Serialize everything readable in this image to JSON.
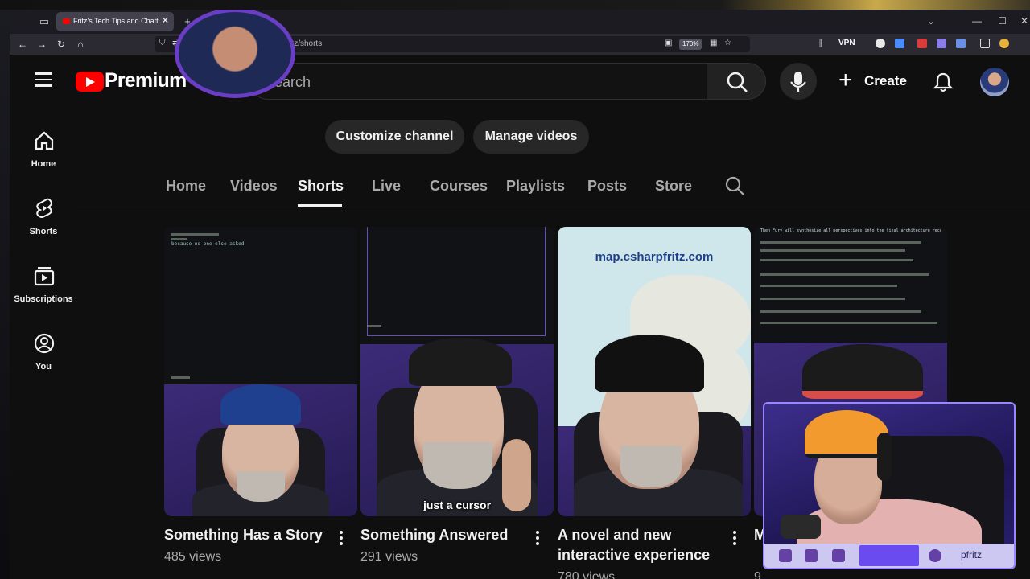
{
  "browser": {
    "tab_title": "Fritz's Tech Tips and Chatter - YouTube",
    "url": "www.youtube.com/@csharpfritz/shorts",
    "zoom": "170%",
    "vpn_label": "VPN",
    "close_glyph": "✕",
    "new_tab_glyph": "+",
    "back_glyph": "←",
    "forward_glyph": "→",
    "reload_glyph": "↻",
    "home_glyph": "⌂",
    "minimize_glyph": "—",
    "maximize_glyph": "☐",
    "list_glyph": "⌄"
  },
  "masthead": {
    "logo_text": "Premium",
    "search_placeholder": "Search",
    "create_label": "Create"
  },
  "guide": {
    "items": [
      {
        "label": "Home",
        "icon": "home-icon"
      },
      {
        "label": "Shorts",
        "icon": "shorts-icon"
      },
      {
        "label": "Subscriptions",
        "icon": "subscriptions-icon"
      },
      {
        "label": "You",
        "icon": "you-icon"
      }
    ]
  },
  "channel": {
    "customize_label": "Customize channel",
    "manage_label": "Manage videos",
    "tabs": [
      "Home",
      "Videos",
      "Shorts",
      "Live",
      "Courses",
      "Playlists",
      "Posts",
      "Store"
    ],
    "active_tab": "Shorts"
  },
  "shorts": [
    {
      "title": "Something Has a Story",
      "views": "485 views",
      "thumb_text": "because no one else asked",
      "caption": ""
    },
    {
      "title": "Something Answered",
      "views": "291 views",
      "thumb_text": "",
      "caption": "just a cursor"
    },
    {
      "title": "A novel and new interactive experience",
      "views": "780 views",
      "thumb_text": "map.csharpfritz.com",
      "caption": ""
    },
    {
      "title": "M",
      "views": "9",
      "thumb_text": "Then Fury will synthesize all perspectives into the final architecture recommendation.",
      "caption": ""
    }
  ],
  "cam": {
    "handle": "pfritz"
  },
  "colors": {
    "accent_red": "#ff0000",
    "background": "#0f0f0f",
    "cam_border": "#9a86ff",
    "cam_pill": "#6a4bf0"
  }
}
